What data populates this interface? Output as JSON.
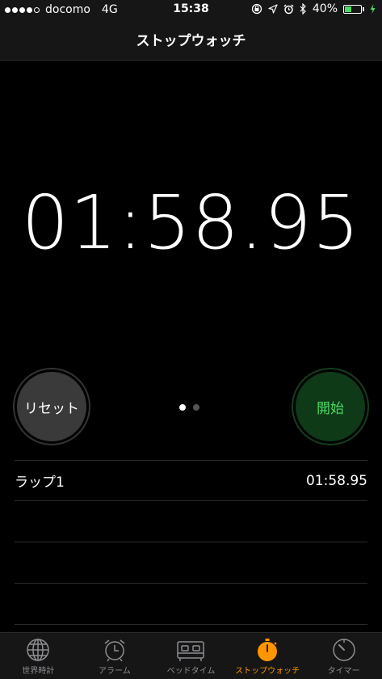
{
  "status": {
    "carrier": "docomo",
    "network": "4G",
    "time": "15:38",
    "battery_percent": "40%",
    "battery_level": 0.4,
    "icons": [
      "orientation-lock-icon",
      "location-icon",
      "alarm-icon",
      "bluetooth-icon",
      "battery-icon",
      "charging-icon"
    ]
  },
  "nav": {
    "title": "ストップウォッチ"
  },
  "timer": {
    "display": "01:58.95"
  },
  "buttons": {
    "reset_label": "リセット",
    "start_label": "開始"
  },
  "pager": {
    "pages": 2,
    "active": 0
  },
  "laps": [
    {
      "label": "ラップ1",
      "time": "01:58.95"
    }
  ],
  "tabs": [
    {
      "label": "世界時計",
      "icon": "globe-icon"
    },
    {
      "label": "アラーム",
      "icon": "alarm-clock-icon"
    },
    {
      "label": "ベッドタイム",
      "icon": "bed-icon"
    },
    {
      "label": "ストップウォッチ",
      "icon": "stopwatch-icon",
      "active": true
    },
    {
      "label": "タイマー",
      "icon": "timer-icon"
    }
  ],
  "colors": {
    "accent": "#ff9500",
    "start_text": "#4cd964",
    "start_bg": "#0e3a18",
    "reset_bg": "#3a3a3a"
  }
}
